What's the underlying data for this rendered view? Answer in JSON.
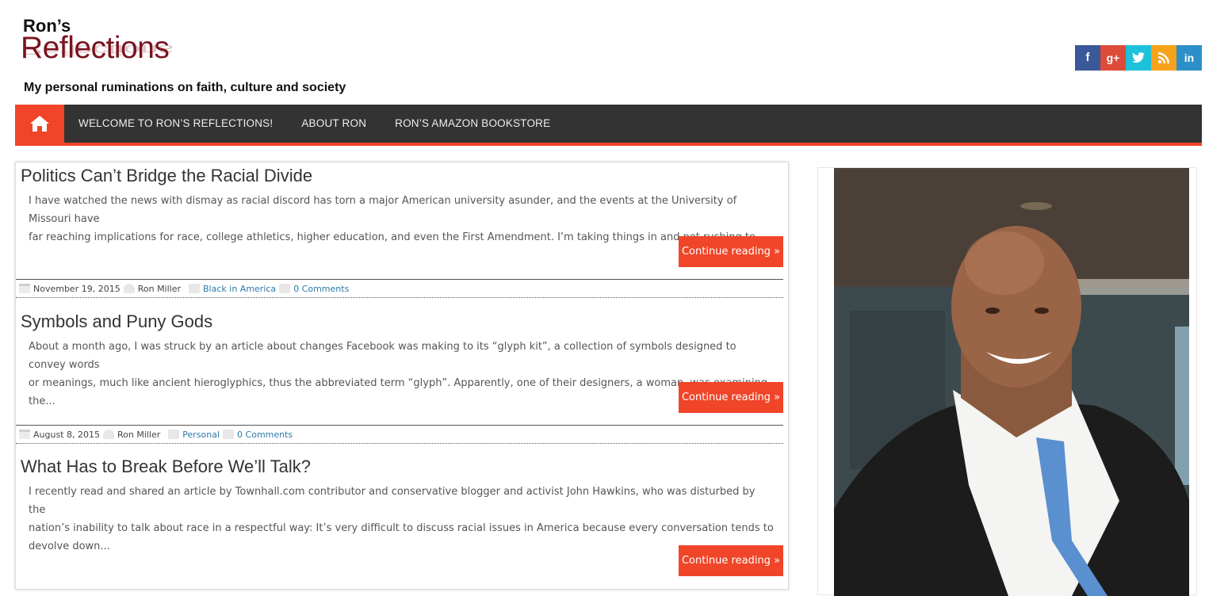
{
  "site": {
    "logo_small": "Ron’s",
    "logo_big": "Reflections",
    "tagline": "My personal ruminations on faith, culture and society"
  },
  "social": [
    {
      "icon": "facebook-icon",
      "glyph": "f",
      "color": "#3b5998"
    },
    {
      "icon": "google-plus-icon",
      "glyph": "g+",
      "color": "#dd4b39"
    },
    {
      "icon": "twitter-icon",
      "glyph": "t",
      "color": "#1dc1d9"
    },
    {
      "icon": "rss-icon",
      "glyph": "rss",
      "color": "#f7a21b"
    },
    {
      "icon": "linkedin-icon",
      "glyph": "in",
      "color": "#2d8fc8"
    }
  ],
  "nav": {
    "home_icon": "home-icon",
    "items": [
      {
        "label": "WELCOME TO RON’S REFLECTIONS!"
      },
      {
        "label": "ABOUT RON"
      },
      {
        "label": "RON’S AMAZON BOOKSTORE"
      }
    ]
  },
  "colors": {
    "accent": "#f04528",
    "nav_bg": "#333333",
    "link": "#2c7aa8"
  },
  "posts": [
    {
      "title": "Politics Can’t Bridge the Racial Divide",
      "excerpt_lines": [
        "I have watched the news with dismay as racial discord has torn a major American university asunder, and the events at the University of Missouri have",
        "far reaching implications for race, college athletics, higher education, and even the First Amendment. I’m taking things in and not rushing to..."
      ],
      "button": "Continue reading »",
      "date": "November 19, 2015",
      "author": "Ron Miller",
      "category": "Black in America",
      "comments": "0 Comments"
    },
    {
      "title": "Symbols and Puny Gods",
      "excerpt_lines": [
        "About a month ago, I was struck by an article about changes Facebook was making to its “glyph kit”, a collection of symbols designed to convey words",
        "or meanings, much like ancient hieroglyphics, thus the abbreviated term “glyph”. Apparently, one of their designers, a woman, was examining the..."
      ],
      "button": "Continue reading »",
      "date": "August 8, 2015",
      "author": "Ron Miller",
      "category": "Personal",
      "comments": "0 Comments"
    },
    {
      "title": "What Has to Break Before We’ll Talk?",
      "excerpt_lines": [
        "I recently read and shared an article by Townhall.com contributor and conservative blogger and activist John Hawkins, who was disturbed by the",
        "nation’s inability to talk about race in a respectful way: It’s very difficult to discuss racial issues in America because every conversation tends to",
        "devolve down..."
      ],
      "button": "Continue reading »"
    }
  ]
}
